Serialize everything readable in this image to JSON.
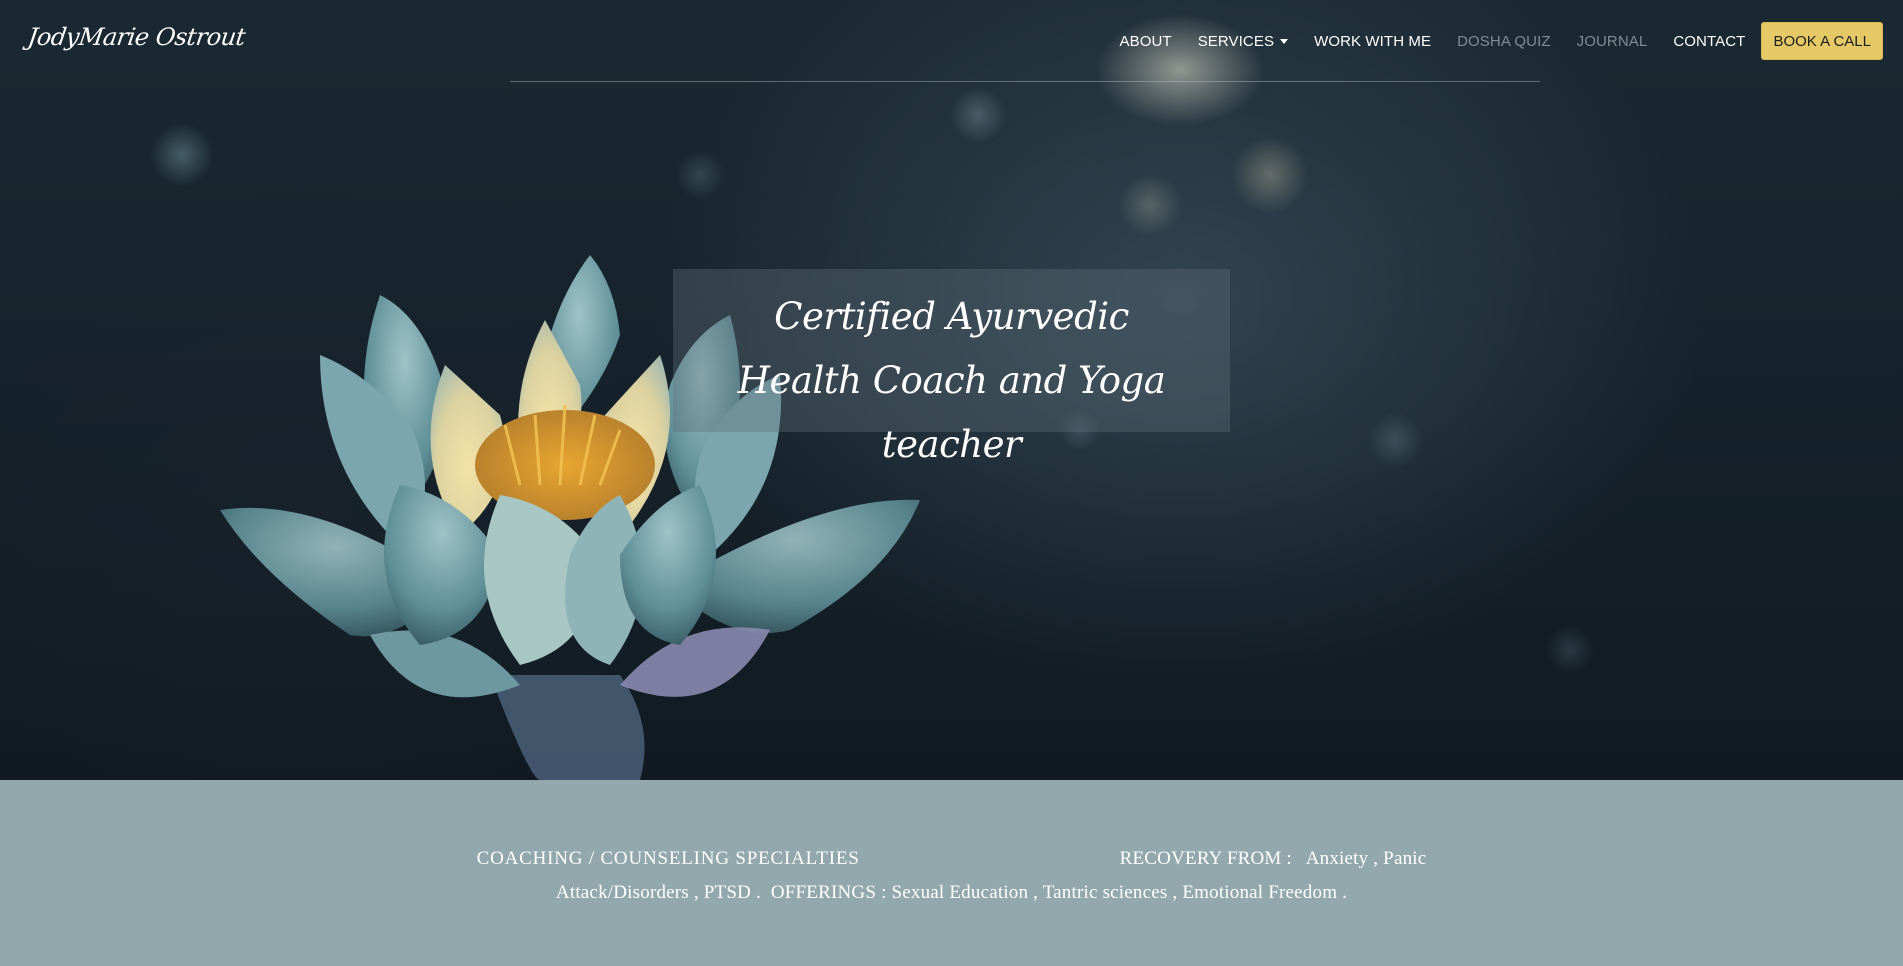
{
  "brand": {
    "logo_text": "JodyMarie Ostrout"
  },
  "nav": {
    "about": "ABOUT",
    "services": "SERVICES",
    "work_with_me": "WORK WITH ME",
    "dosha_quiz": "DOSHA QUIZ",
    "journal": "JOURNAL",
    "contact": "CONTACT",
    "book_call": "BOOK A CALL"
  },
  "hero": {
    "line1": "Certified Ayurvedic",
    "line2": "Health Coach and Yoga teacher"
  },
  "info": {
    "specialties_title": "COACHING / COUNSELING SPECIALTIES",
    "recovery_label": "RECOVERY FROM :",
    "recovery_items": "Anxiety , Panic Attack/Disorders , PTSD .",
    "offerings_label": "OFFERINGS :",
    "offerings_items": "Sexual Education , Tantric sciences , Emotional Freedom ."
  },
  "colors": {
    "accent_button": "#e6c967",
    "info_band": "#93a8ad",
    "muted_nav": "#7f8d94"
  },
  "icons": {
    "services_dropdown": "caret-down-icon",
    "hero_image": "lotus-flower"
  }
}
